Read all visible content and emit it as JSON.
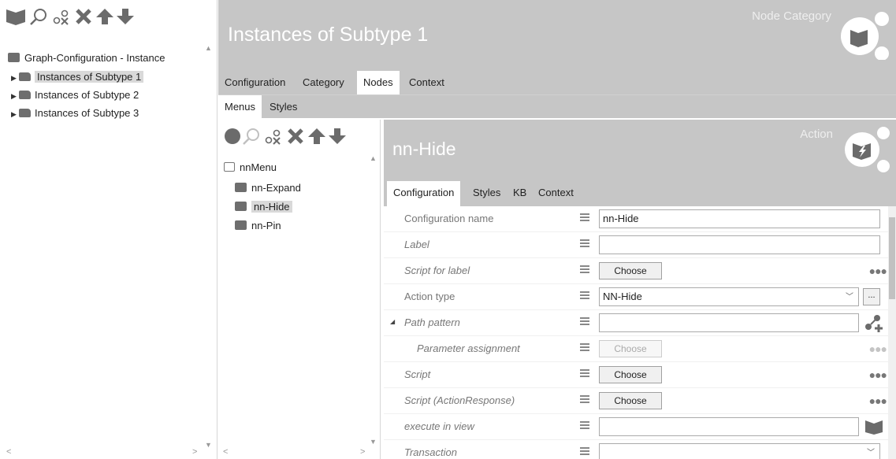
{
  "left": {
    "toolbar_icons": [
      "folder-icon",
      "search-icon",
      "key-icon",
      "delete-icon",
      "arrow-up-icon",
      "arrow-down-icon"
    ],
    "root": {
      "label": "Graph-Configuration - Instance",
      "icon": "graph-config-icon"
    },
    "items": [
      {
        "label": "Instances of Subtype 1",
        "selected": true
      },
      {
        "label": "Instances of Subtype 2",
        "selected": false
      },
      {
        "label": "Instances of Subtype 3",
        "selected": false
      }
    ]
  },
  "header": {
    "title": "Instances of Subtype 1",
    "category": "Node Category",
    "badge_icon": "node-category-icon"
  },
  "tabs_main": [
    {
      "label": "Configuration",
      "active": false
    },
    {
      "label": "Category",
      "active": false
    },
    {
      "label": "Nodes",
      "active": true
    },
    {
      "label": "Context",
      "active": false
    }
  ],
  "tabs_sub": [
    {
      "label": "Menus",
      "active": true
    },
    {
      "label": "Styles",
      "active": false
    }
  ],
  "menu_tree": {
    "toolbar_icons": [
      "circle-icon",
      "search-icon",
      "key-icon",
      "delete-icon",
      "arrow-up-icon",
      "arrow-down-icon"
    ],
    "root": {
      "label": "nnMenu"
    },
    "items": [
      {
        "label": "nn-Expand",
        "selected": false
      },
      {
        "label": "nn-Hide",
        "selected": true
      },
      {
        "label": "nn-Pin",
        "selected": false
      }
    ]
  },
  "action": {
    "title": "nn-Hide",
    "category": "Action",
    "badge_icon": "action-icon"
  },
  "tabs_action": [
    {
      "label": "Configuration",
      "active": true
    },
    {
      "label": "Styles",
      "active": false
    },
    {
      "label": "KB",
      "active": false
    },
    {
      "label": "Context",
      "active": false
    }
  ],
  "properties": {
    "configuration_name": {
      "label": "Configuration name",
      "value": "nn-Hide"
    },
    "label": {
      "label": "Label",
      "value": ""
    },
    "script_for_label": {
      "label": "Script for label",
      "button": "Choose"
    },
    "action_type": {
      "label": "Action type",
      "value": "NN-Hide",
      "extra_button": "..."
    },
    "path_pattern": {
      "label": "Path pattern",
      "value": ""
    },
    "parameter_assignment": {
      "label": "Parameter assignment",
      "button": "Choose"
    },
    "script": {
      "label": "Script",
      "button": "Choose"
    },
    "script_action_response": {
      "label": "Script (ActionResponse)",
      "button": "Choose"
    },
    "execute_in_view": {
      "label": "execute in view",
      "value": ""
    },
    "transaction": {
      "label": "Transaction",
      "value": ""
    }
  },
  "colors": {
    "header_bg": "#c6c6c6",
    "icon_gray": "#6b6b6b",
    "selection": "#d9d9d9"
  }
}
